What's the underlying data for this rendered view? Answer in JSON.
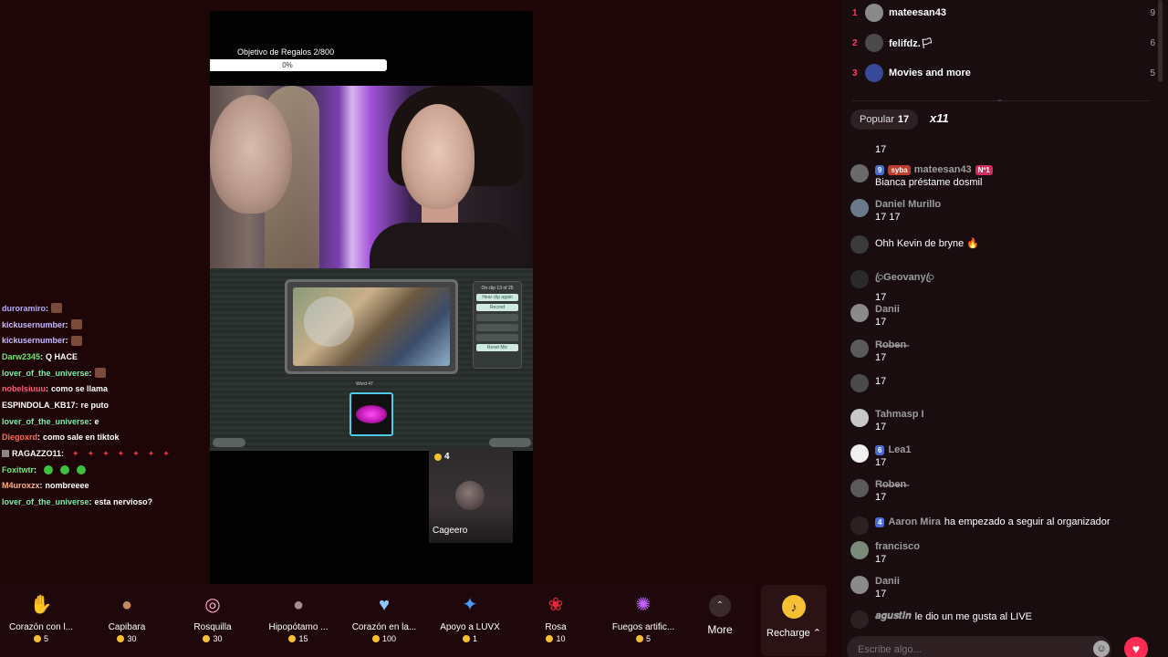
{
  "stream": {
    "goal_label": "Objetivo de Regalos  2/800",
    "goal_percent_label": "0%",
    "goal_progress": 0.0025,
    "game": {
      "panel_title": "On clip 13 of 25",
      "panel_buttons": [
        "Hear clip again",
        "Record",
        "",
        "",
        "",
        "Reset Mic"
      ],
      "word_label": "Word 47"
    },
    "guest": {
      "coins": "4",
      "name": "Cageero"
    }
  },
  "overlay_chat": [
    {
      "user": "duroramiro",
      "sep": " :",
      "msg": "",
      "emotes": 1,
      "color": "#b4a8ff"
    },
    {
      "user": "kickusernumber",
      "sep": " :",
      "msg": "",
      "emotes": 1,
      "color": "#c8b8ff"
    },
    {
      "user": "kickusernumber",
      "sep": " :",
      "msg": "",
      "emotes": 1,
      "color": "#c8b8ff"
    },
    {
      "user": "Darw2345",
      "sep": " :",
      "msg": "Q HACE",
      "color": "#6de86d"
    },
    {
      "user": "lover_of_the_universe",
      "sep": " :",
      "msg": "",
      "emotes": 1,
      "color": "#7af0a8"
    },
    {
      "user": "nobelsiuuu",
      "sep": " :",
      "msg": "como se llama",
      "color": "#ff5a7a"
    },
    {
      "user": "ESPINDOLA_KB17",
      "sep": " :",
      "msg": "re puto",
      "color": "#ffffff"
    },
    {
      "user": "lover_of_the_universe",
      "sep": " :",
      "msg": "e",
      "color": "#7af0a8"
    },
    {
      "user": "Diegoxrd",
      "sep": " :",
      "msg": "como sale en tiktok",
      "color": "#ff6a5a"
    },
    {
      "user": "RAGAZZO11",
      "sep": " :",
      "msg": "",
      "red": 7,
      "color": "#ffffff"
    },
    {
      "user": "Foxitwtr",
      "sep": " :",
      "msg": "",
      "green": 3,
      "color": "#6de86d"
    },
    {
      "user": "M4uroxzx",
      "sep": " :",
      "msg": "nombreeee",
      "color": "#ffb080"
    },
    {
      "user": "lover_of_the_universe",
      "sep": " :",
      "msg": "esta nervioso?",
      "color": "#7af0a8"
    }
  ],
  "gifts": [
    {
      "name": "Corazón con l...",
      "price": "5",
      "icon": "heart-hand-icon",
      "glyph": "✋",
      "color": "#ff6a7a"
    },
    {
      "name": "Capibara",
      "price": "30",
      "icon": "capybara-icon",
      "glyph": "●",
      "color": "#c58a5a"
    },
    {
      "name": "Rosquilla",
      "price": "30",
      "icon": "donut-icon",
      "glyph": "◎",
      "color": "#ffa0d0"
    },
    {
      "name": "Hipopótamo ...",
      "price": "15",
      "icon": "hippo-icon",
      "glyph": "●",
      "color": "#a88a90"
    },
    {
      "name": "Corazón en la...",
      "price": "100",
      "icon": "heart-hands-icon",
      "glyph": "♥",
      "color": "#8ac8ff"
    },
    {
      "name": "Apoyo a LUVX",
      "price": "1",
      "icon": "luvx-icon",
      "glyph": "✦",
      "color": "#4a9cff"
    },
    {
      "name": "Rosa",
      "price": "10",
      "icon": "rose-icon",
      "glyph": "❀",
      "color": "#e8283a"
    },
    {
      "name": "Fuegos artific...",
      "price": "5",
      "icon": "fireworks-icon",
      "glyph": "✺",
      "color": "#c060ff"
    }
  ],
  "more_label": "More",
  "more_glyph": "⌃",
  "recharge_label": "Recharge ⌃",
  "recharge_glyph": "♪",
  "ranking": [
    {
      "rank": "1",
      "name": "mateesan43",
      "score": "9"
    },
    {
      "rank": "2",
      "name": "felifdz.🏳",
      "score": "6"
    },
    {
      "rank": "3",
      "name": "Movies and more",
      "score": "5"
    }
  ],
  "popular": {
    "label": "Popular",
    "value": "17",
    "multiplier": "x11"
  },
  "chat": [
    {
      "user": "",
      "text": "17"
    },
    {
      "user": "mateesan43",
      "level": "9",
      "fan": "syba",
      "top": "Nº1",
      "text": "Bianca préstame dosmil"
    },
    {
      "user": "Daniel Murillo",
      "text": "17 17"
    },
    {
      "user": "",
      "text": "Ohh Kevin de bryne 🔥"
    },
    {
      "user": "ꦿGeovanyꦿ",
      "text": "17"
    },
    {
      "user": "Danii",
      "text": "17"
    },
    {
      "user": "R̶o̶b̶e̶n̶",
      "text": "17"
    },
    {
      "user": "",
      "text": "17"
    },
    {
      "user": "Tahmasp I",
      "text": "17"
    },
    {
      "user": "Lea1",
      "level": "6",
      "text": "17"
    },
    {
      "user": "R̶o̶b̶e̶n̶",
      "text": "17"
    },
    {
      "user": "Aaron Mira",
      "level": "4",
      "inline": "ha empezado a seguir al organizador"
    },
    {
      "user": "francisco",
      "text": "17"
    },
    {
      "user": "Danii",
      "text": "17"
    },
    {
      "user": "𝒂𝒈𝒖𝒔𝒕𝒊𝒏",
      "inline": "le dio un me gusta al LIVE"
    }
  ],
  "input_placeholder": "Escribe algo...",
  "emoji_glyph": "☺",
  "like_glyph": "♥"
}
